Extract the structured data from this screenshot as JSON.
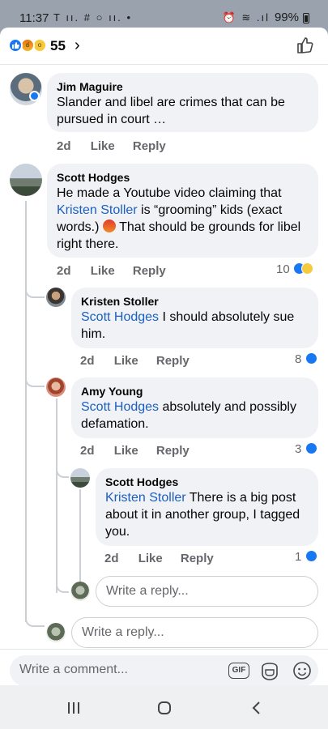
{
  "status_bar": {
    "time": "11:37",
    "left_icons": "T ıı. # ○ ıı. •",
    "right_icons": "⏰ ≋ .ıl",
    "battery": "99%"
  },
  "reactions": {
    "count": "55",
    "types": [
      "like",
      "angry",
      "wow"
    ]
  },
  "comments": [
    {
      "author": "Jim Maguire",
      "text": "Slander and libel are crimes that can be pursued in court …",
      "time": "2d",
      "like": "Like",
      "reply": "Reply"
    },
    {
      "author": "Scott Hodges",
      "text_before": "He made a Youtube video claiming that ",
      "mention": "Kristen Stoller",
      "text_after": " is “grooming” kids (exact words.) ",
      "text_end": " That should be grounds for libel right there.",
      "time": "2d",
      "like": "Like",
      "reply": "Reply",
      "reaction_count": "10",
      "replies": [
        {
          "author": "Kristen Stoller",
          "mention": "Scott Hodges",
          "text": " I should absolutely sue him.",
          "time": "2d",
          "like": "Like",
          "reply": "Reply",
          "reaction_count": "8"
        },
        {
          "author": "Amy Young",
          "mention": "Scott Hodges",
          "text": " absolutely and possibly defamation.",
          "time": "2d",
          "like": "Like",
          "reply": "Reply",
          "reaction_count": "3",
          "replies": [
            {
              "author": "Scott Hodges",
              "mention": "Kristen Stoller",
              "text": " There is a big post about it in another group, I tagged you.",
              "time": "2d",
              "like": "Like",
              "reply": "Reply",
              "reaction_count": "1"
            }
          ]
        }
      ]
    }
  ],
  "reply_placeholder": "Write a reply...",
  "composer": {
    "placeholder": "Write a comment...",
    "gif_label": "GIF"
  },
  "colors": {
    "accent": "#1877f2",
    "mention": "#1b5fc1"
  }
}
